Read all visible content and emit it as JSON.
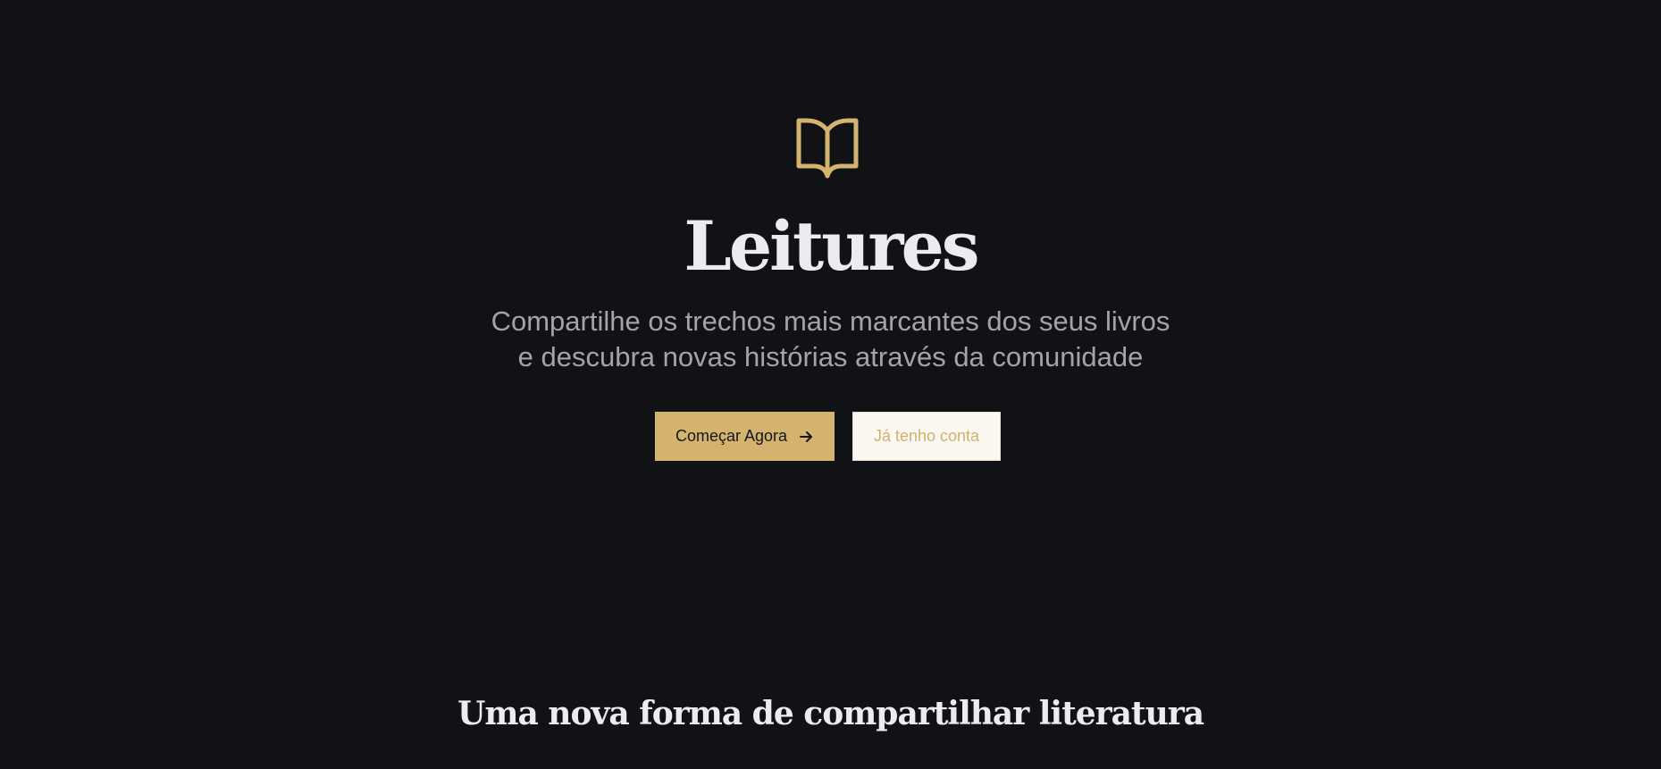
{
  "hero": {
    "icon": "book-open-icon",
    "title": "Leitures",
    "subtitle_lines": [
      "Compartilhe os trechos mais marcantes dos seus livros",
      "e descubra novas histórias através da comunidade"
    ],
    "primary_button_label": "Começar Agora",
    "primary_button_icon": "arrow-right-icon",
    "secondary_button_label": "Já tenho conta"
  },
  "features": {
    "heading": "Uma nova forma de compartilhar literatura"
  },
  "colors": {
    "background": "#111216",
    "accent": "#d4b36f",
    "title_text": "#ececee",
    "subtitle_text": "#a3a4aa",
    "secondary_button_bg": "#fbf8f1"
  }
}
